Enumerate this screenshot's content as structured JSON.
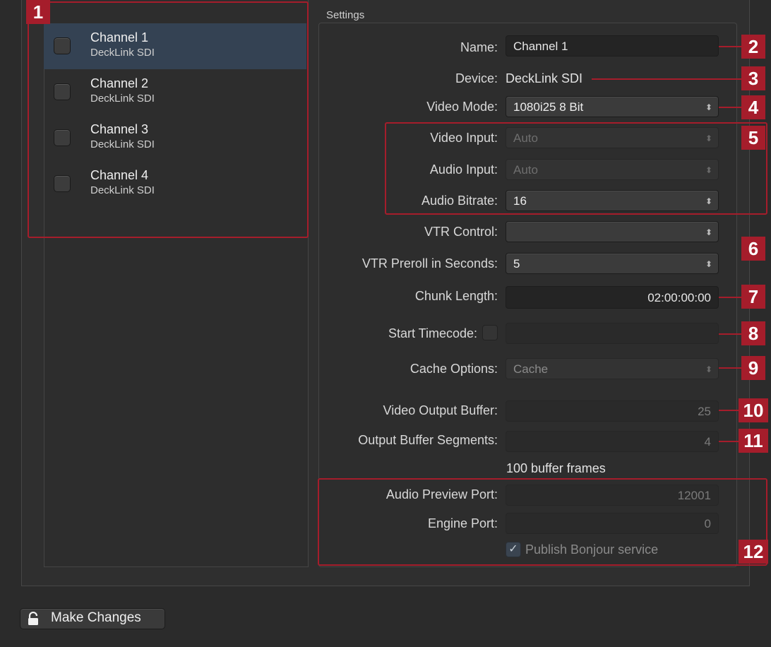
{
  "channels": [
    {
      "name": "Channel 1",
      "device": "DeckLink SDI",
      "selected": true
    },
    {
      "name": "Channel 2",
      "device": "DeckLink SDI",
      "selected": false
    },
    {
      "name": "Channel 3",
      "device": "DeckLink SDI",
      "selected": false
    },
    {
      "name": "Channel 4",
      "device": "DeckLink SDI",
      "selected": false
    }
  ],
  "settings": {
    "title": "Settings",
    "name_label": "Name:",
    "name_value": "Channel 1",
    "device_label": "Device:",
    "device_value": "DeckLink SDI",
    "video_mode_label": "Video Mode:",
    "video_mode_value": "1080i25 8 Bit",
    "video_input_label": "Video Input:",
    "video_input_value": "Auto",
    "audio_input_label": "Audio Input:",
    "audio_input_value": "Auto",
    "audio_bitrate_label": "Audio Bitrate:",
    "audio_bitrate_value": "16",
    "vtr_control_label": "VTR Control:",
    "vtr_control_value": "",
    "vtr_preroll_label": "VTR Preroll in Seconds:",
    "vtr_preroll_value": "5",
    "chunk_length_label": "Chunk Length:",
    "chunk_length_value": "02:00:00:00",
    "start_timecode_label": "Start Timecode:",
    "start_timecode_value": "",
    "cache_options_label": "Cache Options:",
    "cache_options_value": "Cache",
    "video_output_buffer_label": "Video Output Buffer:",
    "video_output_buffer_value": "25",
    "output_buffer_segments_label": "Output Buffer Segments:",
    "output_buffer_segments_value": "4",
    "buffer_frames_text": "100 buffer frames",
    "audio_preview_port_label": "Audio Preview Port:",
    "audio_preview_port_value": "12001",
    "engine_port_label": "Engine Port:",
    "engine_port_value": "0",
    "publish_bonjour_label": "Publish Bonjour service",
    "publish_bonjour_checked": true
  },
  "footer": {
    "make_changes_label": "Make Changes",
    "lock_icon": "lock-icon"
  },
  "callouts": [
    "1",
    "2",
    "3",
    "4",
    "5",
    "6",
    "7",
    "8",
    "9",
    "10",
    "11",
    "12"
  ],
  "icons": {
    "popup_arrows": "⬍",
    "checkmark": "✓"
  },
  "colors": {
    "callout_red": "#a51d2b",
    "selection_blue": "#344253",
    "background": "#2b2b2b"
  }
}
